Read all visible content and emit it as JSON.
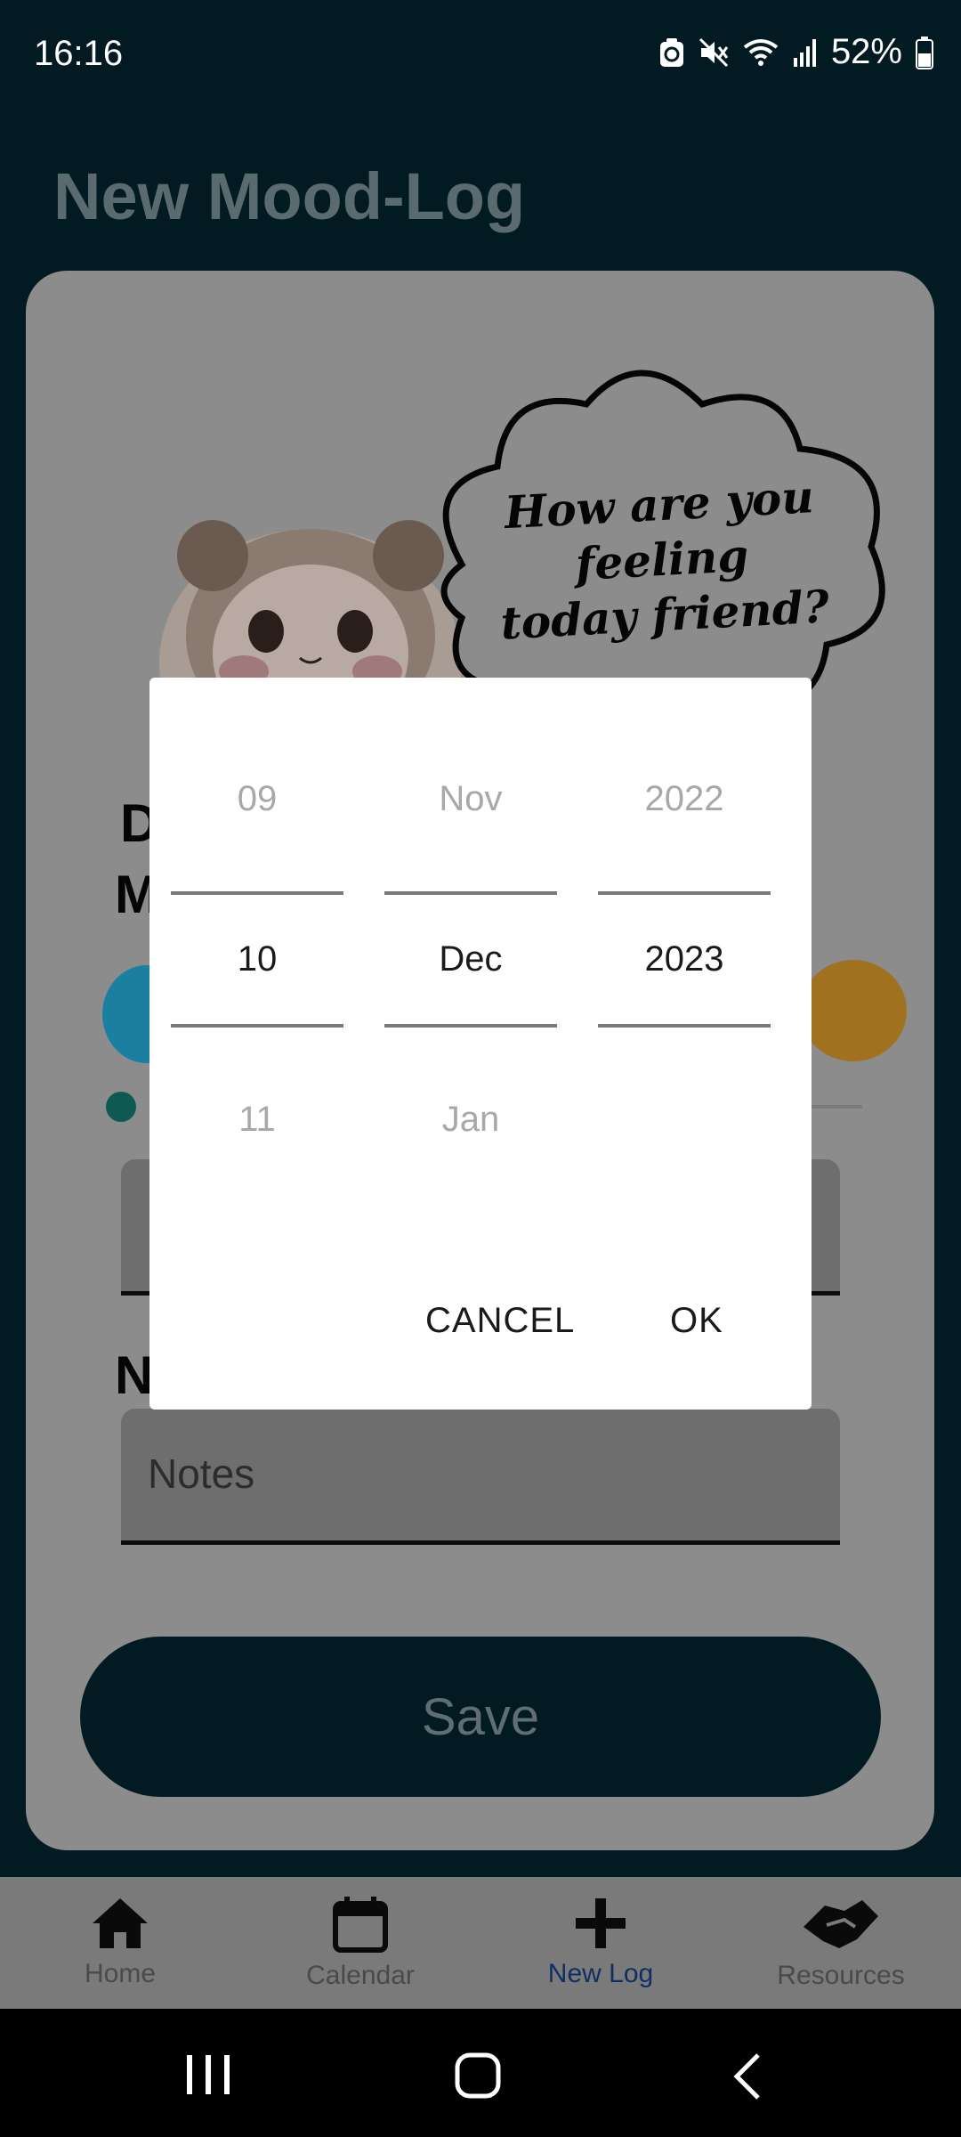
{
  "status_bar": {
    "time": "16:16",
    "battery": "52%"
  },
  "page": {
    "title": "New Mood-Log"
  },
  "card": {
    "speech_line1": "How are you feeling",
    "speech_line2": "today friend?",
    "partial_label_1": "D",
    "partial_label_2": "M",
    "partial_label_3": "N",
    "notes_placeholder": "Notes",
    "save_label": "Save"
  },
  "date_picker": {
    "day": {
      "prev": "09",
      "selected": "10",
      "next": "11"
    },
    "month": {
      "prev": "Nov",
      "selected": "Dec",
      "next": "Jan"
    },
    "year": {
      "prev": "2022",
      "selected": "2023",
      "next": ""
    },
    "cancel_label": "CANCEL",
    "ok_label": "OK"
  },
  "bottom_nav": {
    "items": [
      {
        "label": "Home",
        "icon": "home-icon"
      },
      {
        "label": "Calendar",
        "icon": "calendar-icon"
      },
      {
        "label": "New Log",
        "icon": "plus-icon",
        "active": true
      },
      {
        "label": "Resources",
        "icon": "handshake-icon"
      }
    ]
  },
  "colors": {
    "background": "#021a22",
    "card": "#8c8c8c",
    "active_nav": "#0f2f63",
    "dialog": "#ffffff"
  }
}
